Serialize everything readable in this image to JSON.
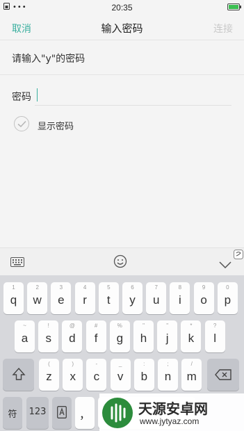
{
  "status_bar": {
    "time": "20:35"
  },
  "header": {
    "cancel_label": "取消",
    "title": "输入密码",
    "connect_label": "连接"
  },
  "prompt": "请输入\"y\"的密码",
  "password": {
    "label": "密码",
    "value": ""
  },
  "show_password": {
    "label": "显示密码",
    "checked": false
  },
  "keyboard": {
    "row1": [
      {
        "main": "q",
        "sub": "1"
      },
      {
        "main": "w",
        "sub": "2"
      },
      {
        "main": "e",
        "sub": "3"
      },
      {
        "main": "r",
        "sub": "4"
      },
      {
        "main": "t",
        "sub": "5"
      },
      {
        "main": "y",
        "sub": "6"
      },
      {
        "main": "u",
        "sub": "7"
      },
      {
        "main": "i",
        "sub": "8"
      },
      {
        "main": "o",
        "sub": "9"
      },
      {
        "main": "p",
        "sub": "0"
      }
    ],
    "row2": [
      {
        "main": "a",
        "sub": "~"
      },
      {
        "main": "s",
        "sub": "!"
      },
      {
        "main": "d",
        "sub": "@"
      },
      {
        "main": "f",
        "sub": "#"
      },
      {
        "main": "g",
        "sub": "%"
      },
      {
        "main": "h",
        "sub": "\""
      },
      {
        "main": "j",
        "sub": "\""
      },
      {
        "main": "k",
        "sub": "*"
      },
      {
        "main": "l",
        "sub": "?"
      }
    ],
    "row3": [
      {
        "main": "z",
        "sub": "("
      },
      {
        "main": "x",
        "sub": ")"
      },
      {
        "main": "c",
        "sub": "-"
      },
      {
        "main": "v",
        "sub": "_"
      },
      {
        "main": "b",
        "sub": ":"
      },
      {
        "main": "n",
        "sub": ";"
      },
      {
        "main": "m",
        "sub": "/"
      }
    ],
    "bottom": {
      "symbol_label": "符",
      "number_label": "123",
      "comma_label": "，"
    }
  },
  "watermark": {
    "brand": "天源安卓网",
    "url": "www.jytyaz.com"
  }
}
